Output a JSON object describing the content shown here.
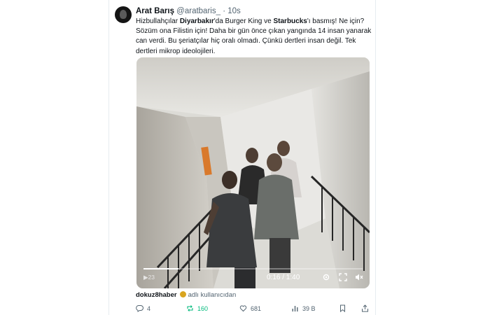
{
  "tweet": {
    "author_name": "Arat Barış",
    "handle": "@aratbaris_",
    "separator": "·",
    "time": "10s",
    "text_parts": [
      {
        "t": "Hizbullahçılar ",
        "b": false
      },
      {
        "t": "Diyarbakır",
        "b": true
      },
      {
        "t": "'da Burger King ve ",
        "b": false
      },
      {
        "t": "Starbucks",
        "b": true
      },
      {
        "t": "'ı basmış! Ne için? Sözüm ona Filistin için! Daha bir gün önce çıkan yangında 14 insan yanarak can verdi. Bu şeriatçılar hiç oralı olmadı. Çünkü dertleri insan değil. Tek dertleri mikrop ideolojileri.",
        "b": false
      }
    ]
  },
  "video": {
    "time_readout": "0:16 / 1:40",
    "progress_fraction": 0.16,
    "left_label": "▶23",
    "icons": [
      "settings-icon",
      "fullscreen-icon",
      "volume-icon"
    ]
  },
  "source": {
    "name": "dokuz8haber",
    "suffix": "adlı kullanıcıdan",
    "badge_color": "#d9a520"
  },
  "actions": {
    "reply_count": "4",
    "retweet_count": "160",
    "like_count": "681",
    "views_count": "39 B",
    "retweet_color": "#00ba7c"
  }
}
